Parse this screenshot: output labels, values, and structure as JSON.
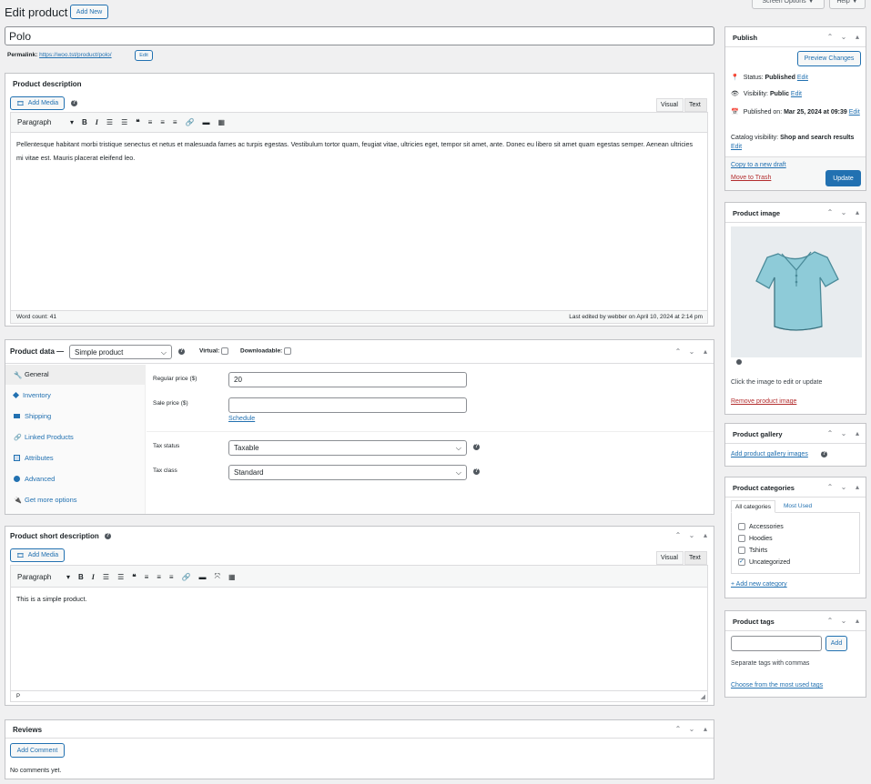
{
  "header": {
    "title": "Edit product",
    "add_new": "Add New",
    "screen_options": "Screen Options ▼",
    "help": "Help ▼"
  },
  "product": {
    "title": "Polo",
    "permalink_label": "Permalink:",
    "permalink_url": "https://woo.tst/product/polo/",
    "permalink_edit": "Edit"
  },
  "description": {
    "title": "Product description",
    "add_media": "Add Media",
    "tab_visual": "Visual",
    "tab_text": "Text",
    "format": "Paragraph",
    "content": "Pellentesque habitant morbi tristique senectus et netus et malesuada fames ac turpis egestas. Vestibulum tortor quam, feugiat vitae, ultricies eget, tempor sit amet, ante. Donec eu libero sit amet quam egestas semper. Aenean ultricies mi vitae est. Mauris placerat eleifend leo.",
    "word_count": "Word count: 41",
    "last_edited": "Last edited by webber on April 10, 2024 at 2:14 pm"
  },
  "product_data": {
    "title": "Product data —",
    "type": "Simple product",
    "virtual": "Virtual:",
    "downloadable": "Downloadable:",
    "tabs": [
      {
        "label": "General",
        "icon": "wrench-icon"
      },
      {
        "label": "Inventory",
        "icon": "tag-icon"
      },
      {
        "label": "Shipping",
        "icon": "truck-icon"
      },
      {
        "label": "Linked Products",
        "icon": "link-icon"
      },
      {
        "label": "Attributes",
        "icon": "table-icon"
      },
      {
        "label": "Advanced",
        "icon": "gear-icon"
      },
      {
        "label": "Get more options",
        "icon": "plugin-icon"
      }
    ],
    "regular_price_label": "Regular price ($)",
    "regular_price": "20",
    "sale_price_label": "Sale price ($)",
    "sale_price": "",
    "schedule": "Schedule",
    "tax_status_label": "Tax status",
    "tax_status": "Taxable",
    "tax_class_label": "Tax class",
    "tax_class": "Standard"
  },
  "short_description": {
    "title": "Product short description",
    "add_media": "Add Media",
    "tab_visual": "Visual",
    "tab_text": "Text",
    "format": "Paragraph",
    "content": "This is a simple product.",
    "path": "P"
  },
  "reviews": {
    "title": "Reviews",
    "add_comment": "Add Comment",
    "empty": "No comments yet."
  },
  "publish": {
    "title": "Publish",
    "preview": "Preview Changes",
    "status_label": "Status:",
    "status": "Published",
    "visibility_label": "Visibility:",
    "visibility": "Public",
    "published_label": "Published on:",
    "published": "Mar 25, 2024 at 09:39",
    "edit": "Edit",
    "catalog_label": "Catalog visibility:",
    "catalog": "Shop and search results",
    "copy": "Copy to a new draft",
    "trash": "Move to Trash",
    "update": "Update"
  },
  "product_image": {
    "title": "Product image",
    "hint": "Click the image to edit or update",
    "remove": "Remove product image"
  },
  "gallery": {
    "title": "Product gallery",
    "add": "Add product gallery images"
  },
  "categories": {
    "title": "Product categories",
    "tab_all": "All categories",
    "tab_most": "Most Used",
    "items": [
      {
        "label": "Accessories",
        "checked": false
      },
      {
        "label": "Hoodies",
        "checked": false
      },
      {
        "label": "Tshirts",
        "checked": false
      },
      {
        "label": "Uncategorized",
        "checked": true
      }
    ],
    "add": "+ Add new category"
  },
  "tags": {
    "title": "Product tags",
    "add": "Add",
    "hint": "Separate tags with commas",
    "choose": "Choose from the most used tags"
  },
  "colors": {
    "accent": "#2271b1",
    "primary_button": "#2271b1",
    "danger": "#b32d2e",
    "shirt": "#8ecbd8"
  }
}
